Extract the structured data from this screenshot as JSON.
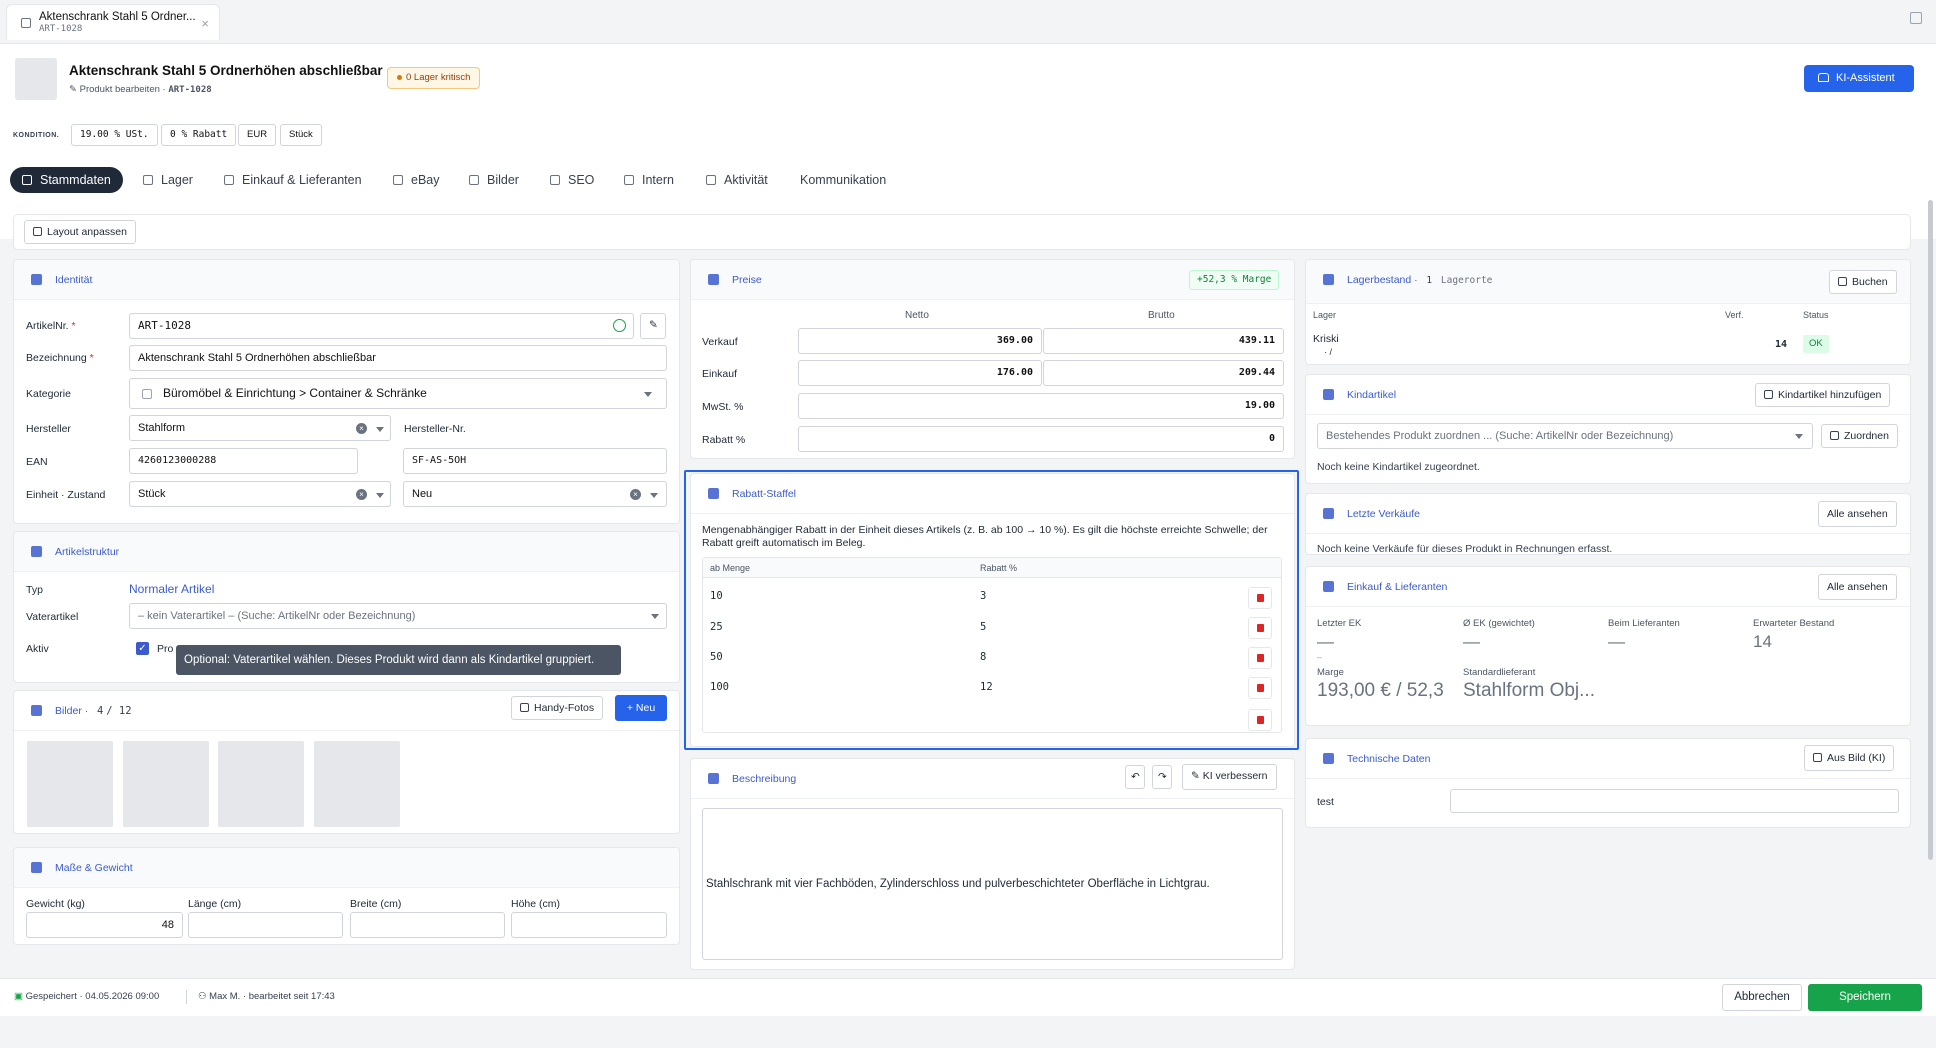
{
  "tab": {
    "title": "Aktenschrank Stahl 5 Ordner...",
    "subtitle": "ART-1028",
    "close": "×"
  },
  "header": {
    "title": "Aktenschrank Stahl 5 Ordnerhöhen abschließbar",
    "subtitle": "Produkt bearbeiten ·",
    "article_code": "ART-1028",
    "stock_badge": "0  Lager kritisch",
    "ki_button": "KI-Assistent"
  },
  "conditions": {
    "label": "KONDITION.",
    "vat": "19.00 % USt.",
    "discount": "0 % Rabatt",
    "currency": "EUR",
    "unit": "Stück"
  },
  "tabs": [
    "Stammdaten",
    "Lager",
    "Einkauf & Lieferanten",
    "eBay",
    "Bilder",
    "SEO",
    "Intern",
    "Aktivität",
    "Kommunikation"
  ],
  "layout_button": "Layout anpassen",
  "identity": {
    "title": "Identität",
    "artnr_label": "ArtikelNr.",
    "artnr_value": "ART-1028",
    "name_label": "Bezeichnung",
    "name_value": "Aktenschrank Stahl 5 Ordnerhöhen abschließbar",
    "category_label": "Kategorie",
    "category_value": "Büromöbel & Einrichtung > Container & Schränke",
    "manufacturer_label": "Hersteller",
    "manufacturer_value": "Stahlform",
    "mfr_no_label": "Hersteller-Nr.",
    "ean_label": "EAN",
    "ean_value": "4260123000288",
    "mfr_no_value": "SF-AS-5OH",
    "unit_label": "Einheit · Zustand",
    "unit_value": "Stück",
    "condition_value": "Neu",
    "required": "*"
  },
  "structure": {
    "title": "Artikelstruktur",
    "type_label": "Typ",
    "type_value": "Normaler Artikel",
    "parent_label": "Vaterartikel",
    "parent_placeholder": "– kein Vaterartikel – (Suche: ArtikelNr oder Bezeichnung)",
    "active_label": "Aktiv",
    "active_text": "Pro",
    "tooltip": "Optional: Vaterartikel wählen. Dieses Produkt wird dann als Kindartikel gruppiert."
  },
  "images": {
    "title": "Bilder ·",
    "count": "4",
    "max": "/ 12",
    "phone_button": "Handy-Fotos",
    "new_button": "+ Neu"
  },
  "dimensions": {
    "title": "Maße & Gewicht",
    "weight_label": "Gewicht (kg)",
    "weight_value": "48",
    "length_label": "Länge (cm)",
    "width_label": "Breite (cm)",
    "height_label": "Höhe (cm)"
  },
  "prices": {
    "title": "Preise",
    "margin": "+52,3 % Marge",
    "net_header": "Netto",
    "gross_header": "Brutto",
    "rows": [
      {
        "label": "Verkauf",
        "net": "369.00",
        "gross": "439.11"
      },
      {
        "label": "Einkauf",
        "net": "176.00",
        "gross": "209.44"
      }
    ],
    "vat_label": "MwSt. %",
    "vat_value": "19.00",
    "discount_label": "Rabatt %",
    "discount_value": "0"
  },
  "tiers": {
    "title": "Rabatt-Staffel",
    "description": "Mengenabhängiger Rabatt in der Einheit dieses Artikels (z. B. ab 100 → 10 %). Es gilt die höchste erreichte Schwelle; der Rabatt greift automatisch im Beleg.",
    "col_qty": "ab Menge",
    "col_pct": "Rabatt %",
    "rows": [
      {
        "qty": "10",
        "pct": "3"
      },
      {
        "qty": "25",
        "pct": "5"
      },
      {
        "qty": "50",
        "pct": "8"
      },
      {
        "qty": "100",
        "pct": "12"
      }
    ]
  },
  "description": {
    "title": "Beschreibung",
    "ki_button": "KI verbessern",
    "text": "Stahlschrank mit vier Fachböden, Zylinderschloss und pulverbeschichteter Oberfläche in Lichtgrau."
  },
  "stock": {
    "title": "Lagerbestand ·",
    "count": "1",
    "suffix": "Lagerorte",
    "book_button": "Buchen",
    "col_store": "Lager",
    "col_avail": "Verf.",
    "col_status": "Status",
    "row_name": "Kriski",
    "row_sub": "·      /",
    "row_avail": "14",
    "row_status": "OK"
  },
  "children": {
    "title": "Kindartikel",
    "add_button": "Kindartikel hinzufügen",
    "select_placeholder": "Bestehendes Produkt zuordnen ... (Suche: ArtikelNr oder Bezeichnung)",
    "assign_button": "Zuordnen",
    "empty": "Noch keine Kindartikel zugeordnet."
  },
  "recent_sales": {
    "title": "Letzte Verkäufe",
    "all_button": "Alle ansehen",
    "empty": "Noch keine Verkäufe für dieses Produkt in Rechnungen erfasst."
  },
  "purchase": {
    "title": "Einkauf & Lieferanten",
    "all_button": "Alle ansehen",
    "last_ek_label": "Letzter EK",
    "last_ek_value": "—",
    "last_ek_sub": "–",
    "avg_ek_label": "Ø EK (gewichtet)",
    "avg_ek_value": "—",
    "supplier_stock_label": "Beim Lieferanten",
    "supplier_stock_value": "—",
    "expected_label": "Erwarteter Bestand",
    "expected_value": "14",
    "margin_label": "Marge",
    "margin_value": "193,00 € / 52,3",
    "default_supplier_label": "Standardlieferant",
    "default_supplier_value": "Stahlform Obj..."
  },
  "tech": {
    "title": "Technische Daten",
    "image_button": "Aus Bild (KI)",
    "row_label": "test"
  },
  "footer": {
    "saved": "Gespeichert · 04.05.2026 09:00",
    "editor": "Max M. · bearbeitet seit 17:43",
    "cancel": "Abbrechen",
    "save": "Speichern"
  }
}
